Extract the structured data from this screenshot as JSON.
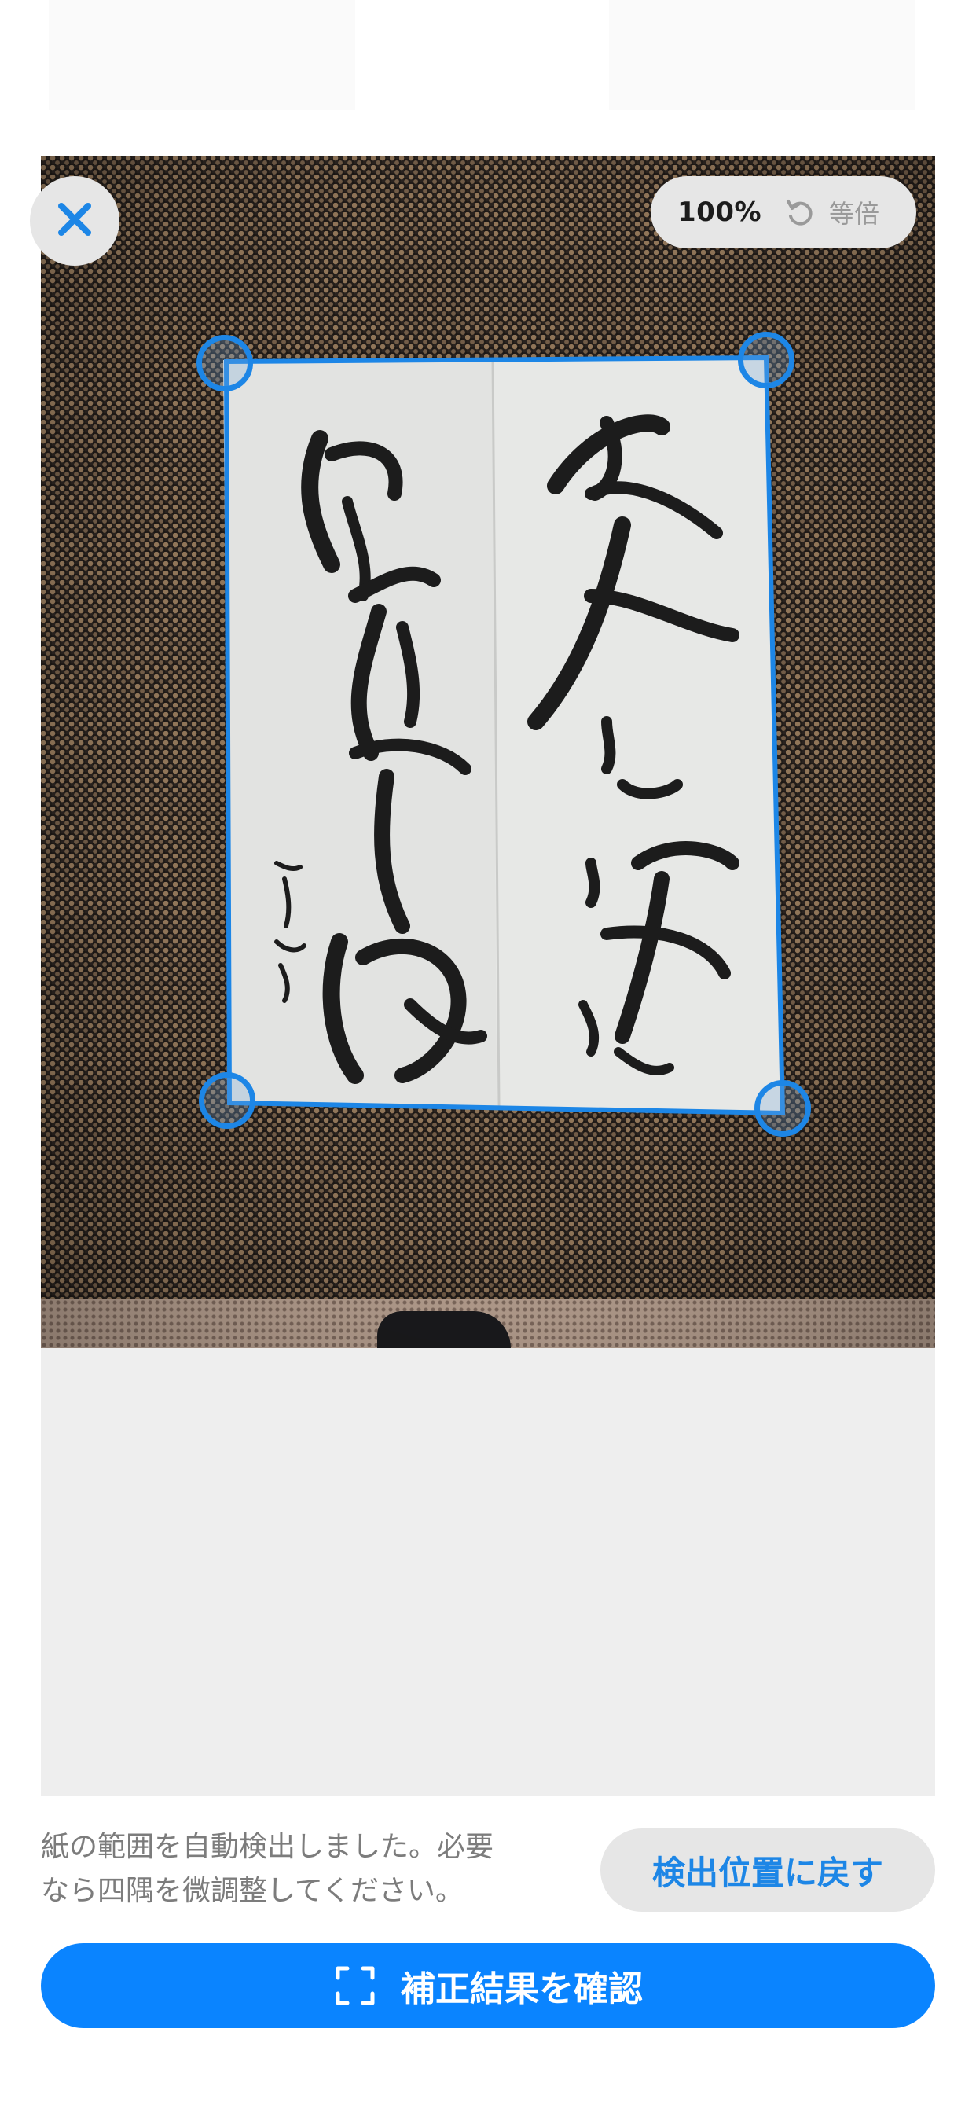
{
  "toolbar": {
    "close_icon": "close-icon",
    "zoom_value": "100%",
    "reset_zoom_icon": "rotate-ccw-icon",
    "reset_zoom_label": "等倍"
  },
  "editor": {
    "handle_color": "#1d86e6"
  },
  "footer": {
    "hint_line1": "紙の範囲を自動検出しました。必要",
    "hint_line2": "なら四隅を微調整してください。",
    "reset_detection_label": "検出位置に戻す",
    "confirm_icon": "scan-frame-icon",
    "confirm_label": "補正結果を確認",
    "accent_color": "#0a84ff"
  }
}
